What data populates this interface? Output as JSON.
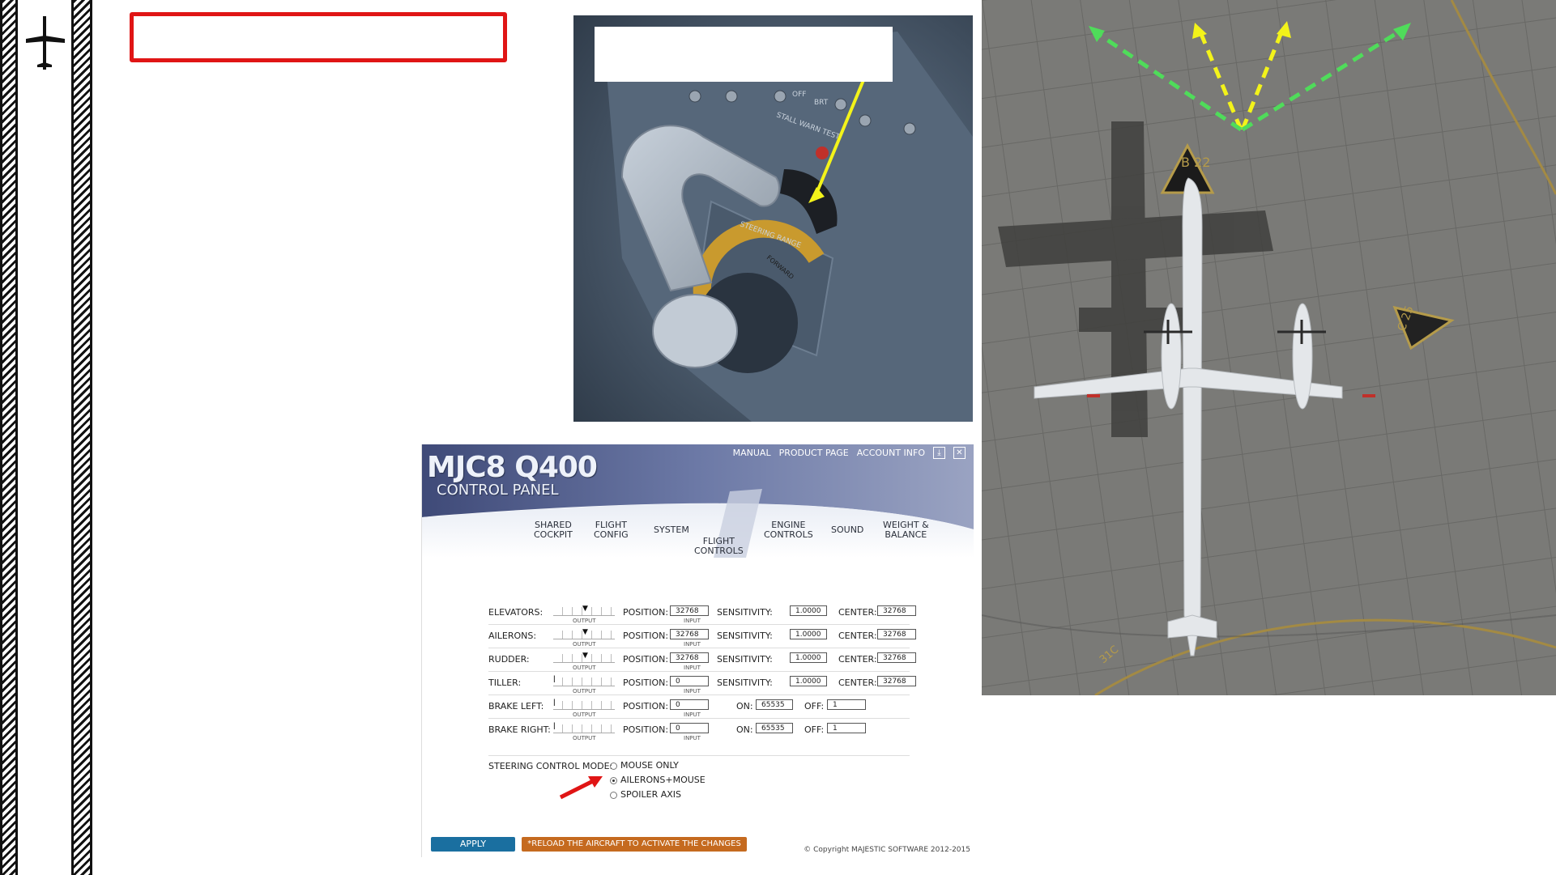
{
  "logo": {
    "icon": "airplane-icon"
  },
  "panel": {
    "brand_line1": "MJC8 Q400",
    "brand_line2": "CONTROL PANEL",
    "links": [
      "MANUAL",
      "PRODUCT PAGE",
      "ACCOUNT INFO"
    ],
    "tabs": [
      "SHARED\nCOCKPIT",
      "FLIGHT\nCONFIG",
      "SYSTEM",
      "FLIGHT\nCONTROLS",
      "ENGINE\nCONTROLS",
      "SOUND",
      "WEIGHT &\nBALANCE"
    ],
    "active_tab": "FLIGHT CONTROLS",
    "labels": {
      "position": "POSITION:",
      "sensitivity": "SENSITIVITY:",
      "center": "CENTER:",
      "on": "ON:",
      "off": "OFF:",
      "output": "OUTPUT",
      "input": "INPUT"
    },
    "rows": [
      {
        "name": "ELEVATORS:",
        "position": "32768",
        "sensitivity": "1.0000",
        "center": "32768"
      },
      {
        "name": "AILERONS:",
        "position": "32768",
        "sensitivity": "1.0000",
        "center": "32768"
      },
      {
        "name": "RUDDER:",
        "position": "32768",
        "sensitivity": "1.0000",
        "center": "32768"
      },
      {
        "name": "TILLER:",
        "position": "0",
        "sensitivity": "1.0000",
        "center": "32768"
      },
      {
        "name": "BRAKE LEFT:",
        "position": "0",
        "on": "65535",
        "off": "1"
      },
      {
        "name": "BRAKE RIGHT:",
        "position": "0",
        "on": "65535",
        "off": "1"
      }
    ],
    "steering_mode_label": "STEERING CONTROL MODE:",
    "steering_options": [
      "MOUSE ONLY",
      "AILERONS+MOUSE",
      "SPOILER AXIS"
    ],
    "steering_selected": "AILERONS+MOUSE",
    "apply_label": "APPLY",
    "reload_notice": "*RELOAD THE AIRCRAFT TO ACTIVATE THE CHANGES",
    "copyright": "© Copyright MAJESTIC SOFTWARE 2012-2015"
  },
  "cockpit": {
    "panel_text": [
      "STEERING RANGE",
      "FORWARD",
      "OFF",
      "BRT",
      "STALL WARN TEST"
    ]
  },
  "aerial": {
    "taxi_signs": [
      "B 22",
      "C 25",
      "31C"
    ]
  },
  "colors": {
    "highlight_red": "#e01515",
    "arrow_yellow": "#f3f31a",
    "arrow_green": "#4fdc5a",
    "apply_blue": "#1a6fa0",
    "reload_orange": "#c56a1f"
  }
}
